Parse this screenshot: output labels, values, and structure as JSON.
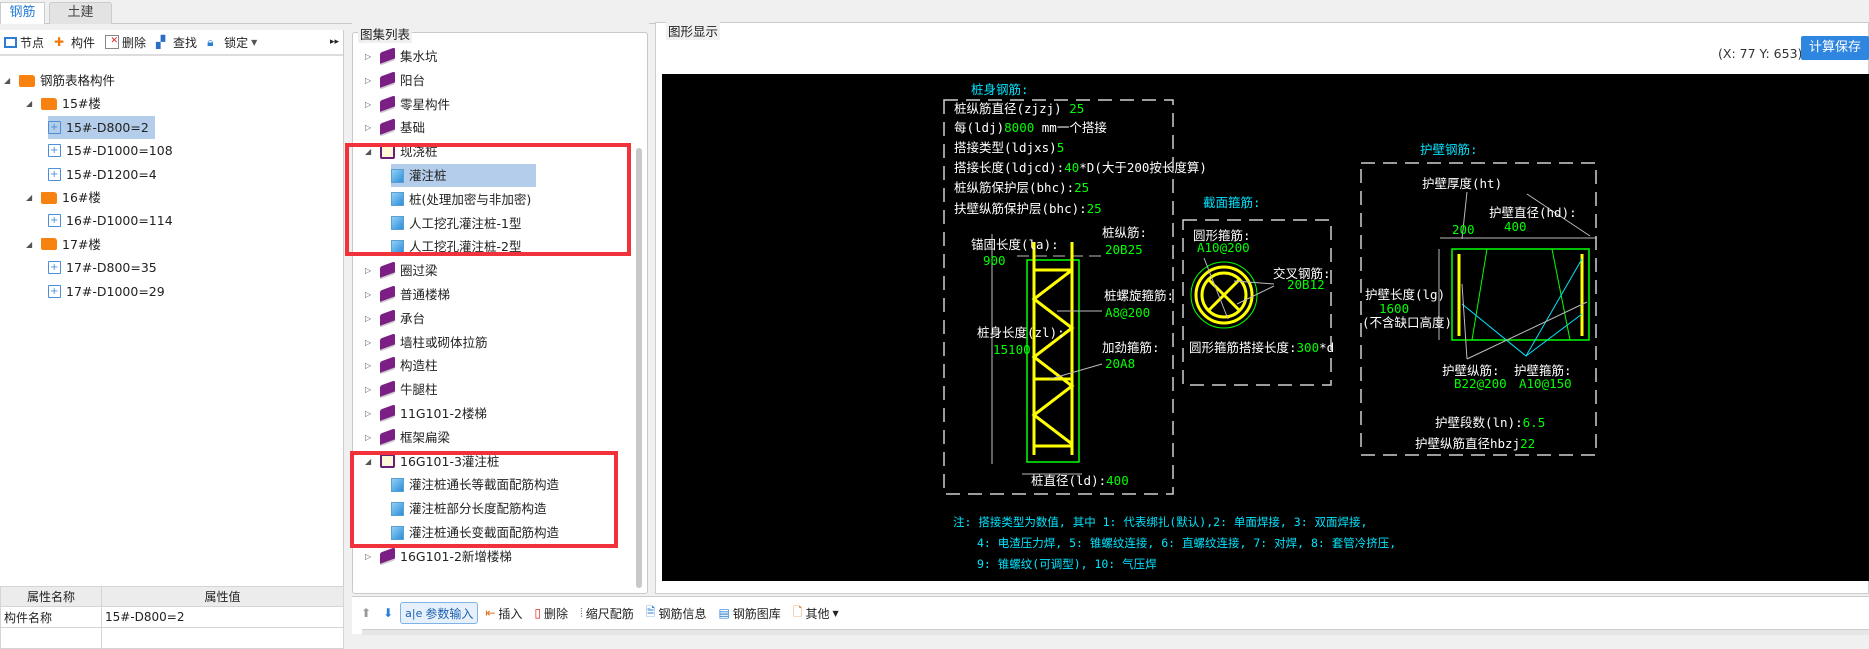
{
  "tabs": [
    {
      "label": "钢筋",
      "active": true
    },
    {
      "label": "土建",
      "active": false
    }
  ],
  "left_toolbar": {
    "node": "节点",
    "component": "构件",
    "delete": "删除",
    "find": "查找",
    "lock": "锁定",
    "more": "▸▸"
  },
  "left_tree": [
    {
      "label": "钢筋表格构件",
      "level": 0,
      "type": "folder"
    },
    {
      "label": "15#楼",
      "level": 1,
      "type": "folder"
    },
    {
      "label": "15#-D800=2",
      "level": 2,
      "type": "pile",
      "selected": true
    },
    {
      "label": "15#-D1000=108",
      "level": 2,
      "type": "pile"
    },
    {
      "label": "15#-D1200=4",
      "level": 2,
      "type": "pile"
    },
    {
      "label": "16#楼",
      "level": 1,
      "type": "folder"
    },
    {
      "label": "16#-D1000=114",
      "level": 2,
      "type": "pile"
    },
    {
      "label": "17#楼",
      "level": 1,
      "type": "folder"
    },
    {
      "label": "17#-D800=35",
      "level": 2,
      "type": "pile"
    },
    {
      "label": "17#-D1000=29",
      "level": 2,
      "type": "pile"
    }
  ],
  "properties": {
    "headers": [
      "属性名称",
      "属性值"
    ],
    "rows": [
      [
        "构件名称",
        "15#-D800=2"
      ]
    ]
  },
  "atlas": {
    "title": "图集列表",
    "items": [
      {
        "label": "集水坑",
        "level": 0,
        "expanded": false
      },
      {
        "label": "阳台",
        "level": 0,
        "expanded": false
      },
      {
        "label": "零星构件",
        "level": 0,
        "expanded": false
      },
      {
        "label": "基础",
        "level": 0,
        "expanded": false
      },
      {
        "label": "现浇桩",
        "level": 0,
        "expanded": true
      },
      {
        "label": "灌注桩",
        "level": 1,
        "selected": true
      },
      {
        "label": "桩(处理加密与非加密)",
        "level": 1
      },
      {
        "label": "人工挖孔灌注桩-1型",
        "level": 1
      },
      {
        "label": "人工挖孔灌注桩-2型",
        "level": 1
      },
      {
        "label": "圈过梁",
        "level": 0,
        "expanded": false
      },
      {
        "label": "普通楼梯",
        "level": 0,
        "expanded": false
      },
      {
        "label": "承台",
        "level": 0,
        "expanded": false
      },
      {
        "label": "墙柱或砌体拉筋",
        "level": 0,
        "expanded": false
      },
      {
        "label": "构造柱",
        "level": 0,
        "expanded": false
      },
      {
        "label": "牛腿柱",
        "level": 0,
        "expanded": false
      },
      {
        "label": "11G101-2楼梯",
        "level": 0,
        "expanded": false
      },
      {
        "label": "框架扁梁",
        "level": 0,
        "expanded": false
      },
      {
        "label": "16G101-3灌注桩",
        "level": 0,
        "expanded": true
      },
      {
        "label": "灌注桩通长等截面配筋构造",
        "level": 1
      },
      {
        "label": "灌注桩部分长度配筋构造",
        "level": 1
      },
      {
        "label": "灌注桩通长变截面配筋构造",
        "level": 1
      },
      {
        "label": "16G101-2新增楼梯",
        "level": 0,
        "expanded": false
      }
    ]
  },
  "display": {
    "title": "图形显示",
    "coords": "(X: 77 Y: 653)",
    "calc_save": "计算保存"
  },
  "drawing": {
    "pile": {
      "title": "桩身钢筋:",
      "lines": [
        [
          "桩纵筋直径(zjzj) ",
          "25"
        ],
        [
          "每(ldj)",
          "8000",
          " mm一个搭接"
        ],
        [
          "搭接类型(ldjxs)",
          "5"
        ],
        [
          "搭接长度(ldjcd):",
          "40",
          "*D(大于200按长度算)"
        ],
        [
          "桩纵筋保护层(bhc):",
          "25"
        ],
        [
          "扶壁纵筋保护层(bhc):",
          "25"
        ]
      ],
      "anchor_label": "锚固长度(la):",
      "anchor_value": "900",
      "long_bar_label": "桩纵筋:",
      "long_bar_value": "20B25",
      "spiral_label": "桩螺旋箍筋:",
      "spiral_value": "A8@200",
      "length_label": "桩身长度(zl):",
      "length_value": "15100",
      "stiff_label": "加劲箍筋:",
      "stiff_value": "20A8",
      "diameter_label": "桩直径(ld):",
      "diameter_value": "400"
    },
    "section": {
      "title": "截面箍筋:",
      "hoop_label": "圆形箍筋:",
      "hoop_value": "A10@200",
      "cross_label": "交叉钢筋:",
      "cross_value": "20B12",
      "lap_label": "圆形箍筋搭接长度:",
      "lap_value": "300",
      "lap_unit": "*d"
    },
    "wall": {
      "title": "护壁钢筋:",
      "thick_label": "护壁厚度(ht)",
      "thick_value": "200",
      "diam_label": "护壁直径(hd):",
      "diam_value": "400",
      "len_label": "护壁长度(lg)",
      "len_value": "1600",
      "len_note": "(不含缺口高度)",
      "long_label": "护壁纵筋:",
      "long_value": "B22@200",
      "hoop_label": "护壁箍筋:",
      "hoop_value": "A10@150",
      "seg_label": "护壁段数(ln):",
      "seg_value": "6.5",
      "dia_label": "护壁纵筋直径hbzj",
      "dia_value": "22"
    },
    "notes": [
      "注: 搭接类型为数值, 其中 1: 代表绑扎(默认),2: 单面焊接, 3: 双面焊接,",
      "4: 电渣压力焊, 5: 锥螺纹连接, 6: 直螺纹连接, 7: 对焊, 8: 套管冷挤压,",
      "9: 锥螺纹(可调型), 10: 气压焊"
    ],
    "colors": {
      "bg": "#000000",
      "white": "#ffffff",
      "green": "#00ff00",
      "yellow": "#ffff00",
      "cyan": "#00ffff"
    }
  },
  "bottom_toolbar": {
    "up": "上移",
    "down": "下移",
    "param": "参数输入",
    "insert": "插入",
    "delete": "删除",
    "scale": "缩尺配筋",
    "info": "钢筋信息",
    "library": "钢筋图库",
    "other": "其他"
  }
}
